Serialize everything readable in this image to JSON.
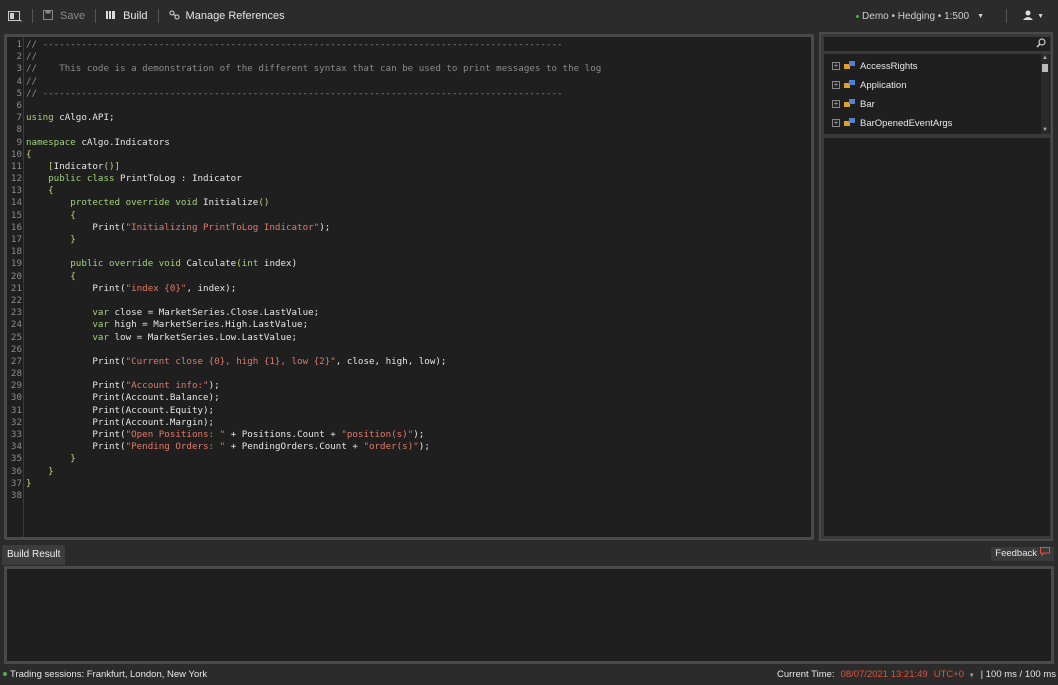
{
  "toolbar": {
    "save_label": "Save",
    "build_label": "Build",
    "references_label": "Manage References",
    "account_label": "Demo • Hedging • 1:500"
  },
  "editor": {
    "lines": [
      [
        {
          "t": "// ----------------------------------------------------------------------------------------------",
          "c": "com"
        }
      ],
      [
        {
          "t": "//",
          "c": "com"
        }
      ],
      [
        {
          "t": "//    This code is a demonstration of the different syntax that can be used to print messages to the log",
          "c": "com"
        }
      ],
      [
        {
          "t": "//",
          "c": "com"
        }
      ],
      [
        {
          "t": "// ----------------------------------------------------------------------------------------------",
          "c": "com"
        }
      ],
      [],
      [
        {
          "t": "using",
          "c": "kw"
        },
        {
          "t": " cAlgo.API;",
          "c": "pln"
        }
      ],
      [],
      [
        {
          "t": "namespace",
          "c": "kw"
        },
        {
          "t": " cAlgo.Indicators",
          "c": "pln"
        }
      ],
      [
        {
          "t": "{",
          "c": "attr"
        }
      ],
      [
        {
          "t": "    [",
          "c": "attr"
        },
        {
          "t": "Indicator",
          "c": "pln"
        },
        {
          "t": "()]",
          "c": "attr"
        }
      ],
      [
        {
          "t": "    public class",
          "c": "kw"
        },
        {
          "t": " PrintToLog : Indicator",
          "c": "pln"
        }
      ],
      [
        {
          "t": "    {",
          "c": "attr"
        }
      ],
      [
        {
          "t": "        protected override void",
          "c": "kw"
        },
        {
          "t": " Initialize",
          "c": "pln"
        },
        {
          "t": "()",
          "c": "attr"
        }
      ],
      [
        {
          "t": "        {",
          "c": "attr"
        }
      ],
      [
        {
          "t": "            Print(",
          "c": "pln"
        },
        {
          "t": "\"Initializing PrintToLog Indicator\"",
          "c": "str"
        },
        {
          "t": ");",
          "c": "pln"
        }
      ],
      [
        {
          "t": "        }",
          "c": "attr"
        }
      ],
      [],
      [
        {
          "t": "        public override void",
          "c": "kw"
        },
        {
          "t": " Calculate",
          "c": "pln"
        },
        {
          "t": "(",
          "c": "attr"
        },
        {
          "t": "int",
          "c": "kw"
        },
        {
          "t": " index)",
          "c": "pln"
        }
      ],
      [
        {
          "t": "        {",
          "c": "attr"
        }
      ],
      [
        {
          "t": "            Print(",
          "c": "pln"
        },
        {
          "t": "\"index {0}\"",
          "c": "str"
        },
        {
          "t": ", index);",
          "c": "pln"
        }
      ],
      [],
      [
        {
          "t": "            var",
          "c": "kw"
        },
        {
          "t": " close = MarketSeries.Close.LastValue;",
          "c": "pln"
        }
      ],
      [
        {
          "t": "            var",
          "c": "kw"
        },
        {
          "t": " high = MarketSeries.High.LastValue;",
          "c": "pln"
        }
      ],
      [
        {
          "t": "            var",
          "c": "kw"
        },
        {
          "t": " low = MarketSeries.Low.LastValue;",
          "c": "pln"
        }
      ],
      [],
      [
        {
          "t": "            Print(",
          "c": "pln"
        },
        {
          "t": "\"Current close {0}, high {1}, low {2}\"",
          "c": "str"
        },
        {
          "t": ", close, high, low);",
          "c": "pln"
        }
      ],
      [],
      [
        {
          "t": "            Print(",
          "c": "pln"
        },
        {
          "t": "\"Account info:\"",
          "c": "str"
        },
        {
          "t": ");",
          "c": "pln"
        }
      ],
      [
        {
          "t": "            Print(Account.Balance);",
          "c": "pln"
        }
      ],
      [
        {
          "t": "            Print(Account.Equity);",
          "c": "pln"
        }
      ],
      [
        {
          "t": "            Print(Account.Margin);",
          "c": "pln"
        }
      ],
      [
        {
          "t": "            Print(",
          "c": "pln"
        },
        {
          "t": "\"Open Positions: \"",
          "c": "str"
        },
        {
          "t": " + Positions.Count + ",
          "c": "pln"
        },
        {
          "t": "\"position(s)\"",
          "c": "str"
        },
        {
          "t": ");",
          "c": "pln"
        }
      ],
      [
        {
          "t": "            Print(",
          "c": "pln"
        },
        {
          "t": "\"Pending Orders: \"",
          "c": "str"
        },
        {
          "t": " + PendingOrders.Count + ",
          "c": "pln"
        },
        {
          "t": "\"order(s)\"",
          "c": "str"
        },
        {
          "t": ");",
          "c": "pln"
        }
      ],
      [
        {
          "t": "        }",
          "c": "attr"
        }
      ],
      [
        {
          "t": "    }",
          "c": "attr"
        }
      ],
      [
        {
          "t": "}",
          "c": "attr"
        }
      ],
      []
    ]
  },
  "tree": {
    "items": [
      "AccessRights",
      "Application",
      "Bar",
      "BarOpenedEventArgs"
    ]
  },
  "bottom": {
    "tab_label": "Build Result",
    "feedback_label": "Feedback"
  },
  "status": {
    "sessions": "Trading sessions: Frankfurt, London, New York",
    "time_label": "Current Time:",
    "time_value": "08/07/2021 13:21:49",
    "tz": "UTC+0",
    "latency": "| 100 ms / 100 ms"
  },
  "colors": {
    "accent_red": "#e0533a",
    "status_green": "#4caf50"
  }
}
